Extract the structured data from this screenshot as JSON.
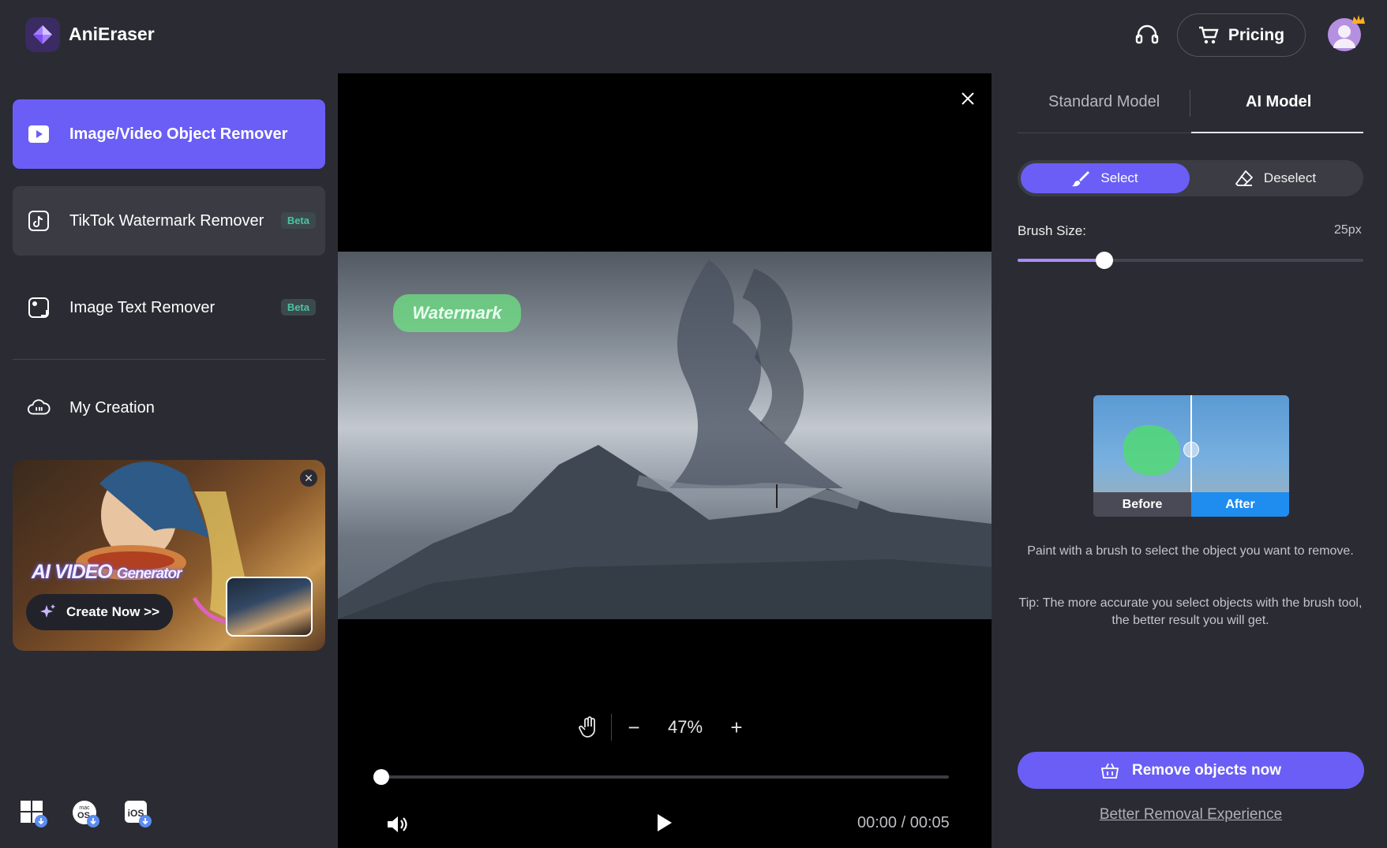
{
  "app": {
    "title": "AniEraser"
  },
  "header": {
    "pricing_label": "Pricing"
  },
  "sidebar": {
    "items": [
      {
        "label": "Image/Video Object Remover",
        "active": true
      },
      {
        "label": "TikTok Watermark Remover",
        "badge": "Beta"
      },
      {
        "label": "Image Text Remover",
        "badge": "Beta"
      },
      {
        "label": "My Creation"
      }
    ],
    "banner": {
      "title_main": "AI VIDEO",
      "title_gen": "Generator",
      "cta": "Create Now >>"
    },
    "os_icons": [
      "windows-download-icon",
      "macos-download-icon",
      "ios-download-icon"
    ],
    "os_labels": {
      "mac": "mac",
      "os": "OS",
      "ios": "iOS"
    }
  },
  "preview": {
    "watermark_text": "Watermark",
    "zoom": "47%",
    "zoom_minus": "−",
    "zoom_plus": "+",
    "time": "00:00 / 00:05",
    "progress": 0
  },
  "panel": {
    "tabs": [
      {
        "label": "Standard Model"
      },
      {
        "label": "AI Model",
        "active": true
      }
    ],
    "mode_select": "Select",
    "mode_deselect": "Deselect",
    "brush_label": "Brush Size:",
    "brush_value": "25px",
    "brush_fraction": 0.25,
    "before_label": "Before",
    "after_label": "After",
    "hint": "Paint with a brush to select the object you want to remove.",
    "tip": "Tip: The more accurate you select objects with the brush tool, the better result you will get.",
    "remove_button": "Remove objects now",
    "better_link": "Better Removal Experience"
  },
  "colors": {
    "accent": "#6a5ef6",
    "background": "#2b2b33",
    "after_blue": "#1f8cf0",
    "beta_green": "#4bc2a4"
  }
}
